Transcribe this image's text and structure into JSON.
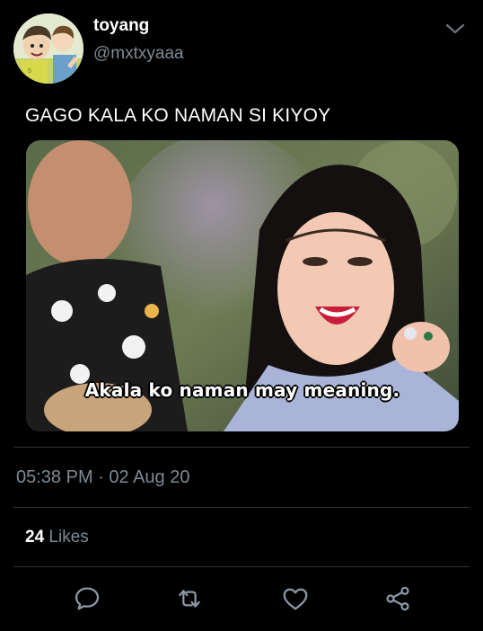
{
  "user": {
    "display_name": "toyang",
    "handle": "@mxtxyaaa"
  },
  "tweet": {
    "text": "GAGO KALA KO NAMAN SI KIYOY",
    "media_caption": "Akala ko naman may meaning.",
    "timestamp": "05:38 PM · 02 Aug 20",
    "likes_count": "24",
    "likes_label": "Likes"
  },
  "actions": [
    {
      "icon": "reply-icon"
    },
    {
      "icon": "retweet-icon"
    },
    {
      "icon": "like-icon"
    },
    {
      "icon": "share-icon"
    }
  ],
  "colors": {
    "background": "#000000",
    "primary_text": "#ffffff",
    "secondary_text": "#7f8a93",
    "divider": "#2f3336",
    "icon": "#8b98a5"
  }
}
